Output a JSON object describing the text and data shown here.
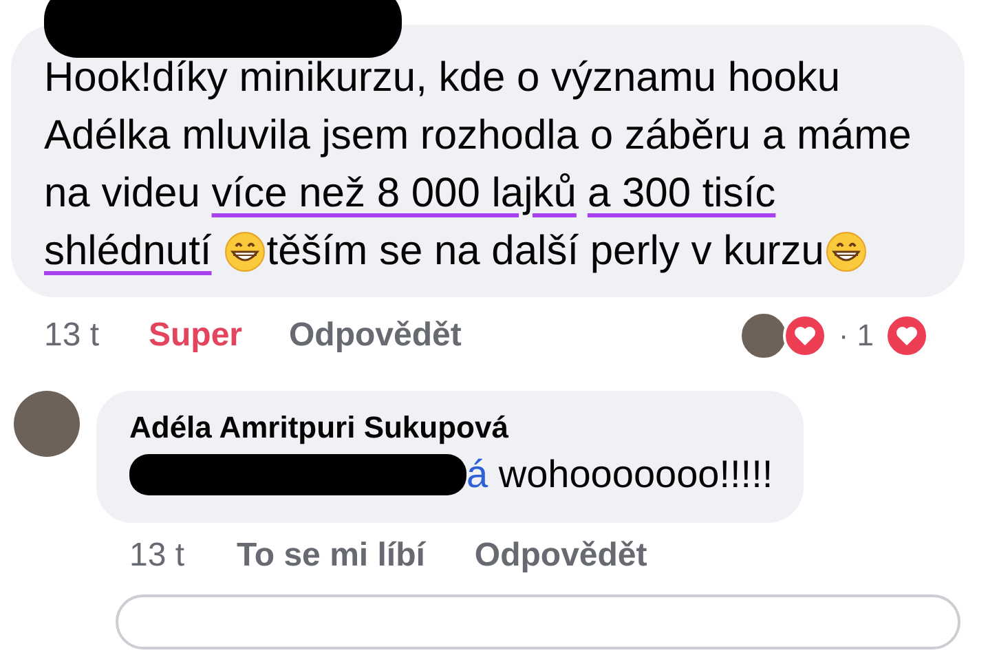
{
  "comments": [
    {
      "kind": "comment",
      "segments": [
        {
          "kind": "text",
          "text": "Hook!díky minikurzu, kde o významu hooku Adélka mluvila jsem rozhodla o záběru a máme na videu "
        },
        {
          "kind": "marked",
          "text": "více než 8 000 lajků"
        },
        {
          "kind": "marked",
          "text": "a 300 tisíc shlédnutí"
        },
        {
          "kind": "emoji"
        },
        {
          "kind": "text",
          "text": "těším se na další perly v kurzu"
        },
        {
          "kind": "emoji"
        }
      ],
      "time": "13 t",
      "actions": [
        {
          "label": "Super",
          "selected": true
        },
        {
          "label": "Odpovědět",
          "selected": false
        }
      ],
      "reactions": {
        "count": "· 1",
        "reacted": true
      }
    },
    {
      "kind": "reply",
      "author": "Adéla Amritpuri Sukupová",
      "segments": [
        {
          "kind": "redacted"
        },
        {
          "kind": "mention",
          "text": "á"
        },
        {
          "kind": "text",
          "text": " wohooooooo!!!!!"
        }
      ],
      "time": "13 t",
      "actions": [
        {
          "label": "To se mi líbí",
          "selected": false
        },
        {
          "label": "Odpovědět",
          "selected": false
        }
      ]
    }
  ]
}
